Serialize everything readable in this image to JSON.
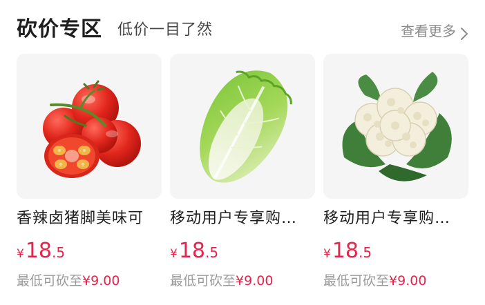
{
  "header": {
    "title": "砍价专区",
    "subtitle": "低价一目了然",
    "more_label": "查看更多"
  },
  "products": [
    {
      "image": "tomato",
      "name": "香辣卤猪脚美味可",
      "price_symbol": "¥",
      "price_int": "18",
      "price_dec": ".5",
      "floor_label": "最低可砍至",
      "floor_value": "¥9.00"
    },
    {
      "image": "napa-cabbage",
      "name": "移动用户专享购…",
      "price_symbol": "¥",
      "price_int": "18",
      "price_dec": ".5",
      "floor_label": "最低可砍至",
      "floor_value": "¥9.00"
    },
    {
      "image": "cauliflower",
      "name": "移动用户专享购…",
      "price_symbol": "¥",
      "price_int": "18",
      "price_dec": ".5",
      "floor_label": "最低可砍至",
      "floor_value": "¥9.00"
    }
  ],
  "colors": {
    "accent": "#e8234a",
    "muted": "#9a9a9a",
    "card_bg": "#f5f5f5"
  }
}
